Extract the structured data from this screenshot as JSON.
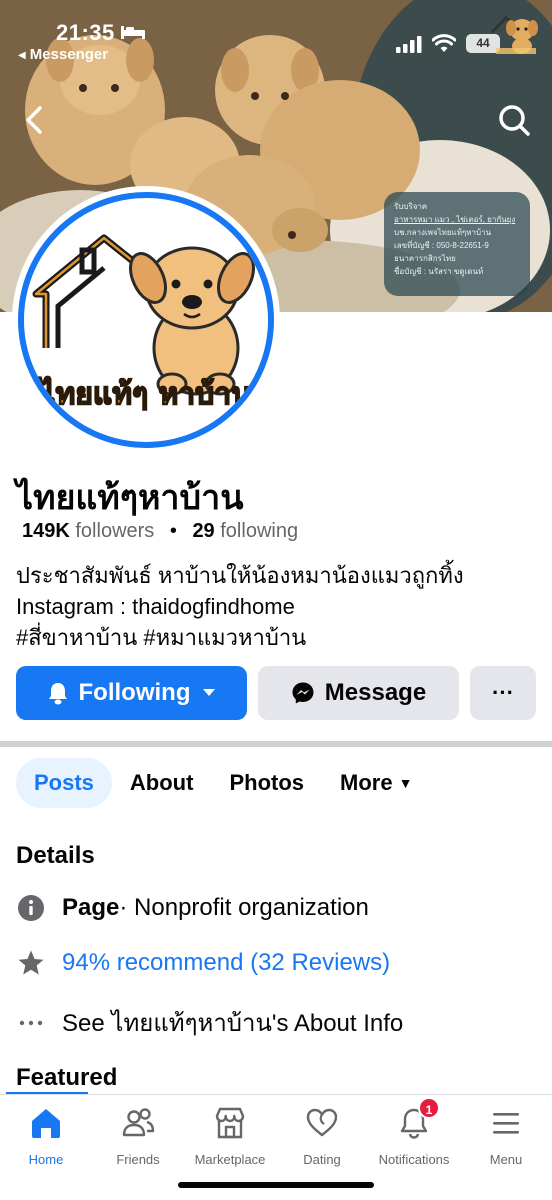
{
  "status_bar": {
    "time": "21:35",
    "back_app": "Messenger",
    "battery": "44"
  },
  "cover": {
    "donate_lines": [
      "รับบริจาค",
      "อาหารหมา แมว , ไข่เตอร์, ยากันยุง",
      "บช.กลางเพจไทยแท้ๆหาบ้าน",
      "เลขที่บัญชี : 050-8-22651-9",
      "ธนาคารกสิกรไทย",
      "ชื่อบัญชี : นรัสรา ขดูเดนท์"
    ]
  },
  "avatar": {
    "logo_text": "ไทยแท้ๆ หาบ้าน"
  },
  "profile": {
    "name": "ไทยแท้ๆหาบ้าน",
    "followers_count": "149K",
    "followers_label": "followers",
    "following_count": "29",
    "following_label": "following",
    "bio": [
      "ประชาสัมพันธ์ หาบ้านให้น้องหมาน้องแมวถูกทิ้ง",
      "Instagram : thaidogfindhome",
      "#สี่ขาหาบ้าน #หมาแมวหาบ้าน"
    ]
  },
  "actions": {
    "following_label": "Following",
    "message_label": "Message",
    "more_label": "···"
  },
  "tabs": [
    {
      "label": "Posts",
      "active": true
    },
    {
      "label": "About",
      "active": false
    },
    {
      "label": "Photos",
      "active": false
    },
    {
      "label": "More",
      "active": false
    }
  ],
  "details": {
    "title": "Details",
    "page_type_bold": "Page",
    "page_type_rest": " · Nonprofit organization",
    "recommend": "94% recommend (32 Reviews)",
    "see_about": "See ไทยแท้ๆหาบ้าน's About Info"
  },
  "featured": {
    "title": "Featured"
  },
  "bottom_nav": [
    {
      "label": "Home",
      "icon": "home-icon",
      "active": true
    },
    {
      "label": "Friends",
      "icon": "friends-icon",
      "active": false
    },
    {
      "label": "Marketplace",
      "icon": "marketplace-icon",
      "active": false
    },
    {
      "label": "Dating",
      "icon": "dating-icon",
      "active": false
    },
    {
      "label": "Notifications",
      "icon": "bell-icon",
      "active": false,
      "badge": "1"
    },
    {
      "label": "Menu",
      "icon": "menu-icon",
      "active": false
    }
  ],
  "colors": {
    "accent": "#1877f2",
    "badge": "#e41e3f",
    "button_gray": "#e4e6eb"
  }
}
